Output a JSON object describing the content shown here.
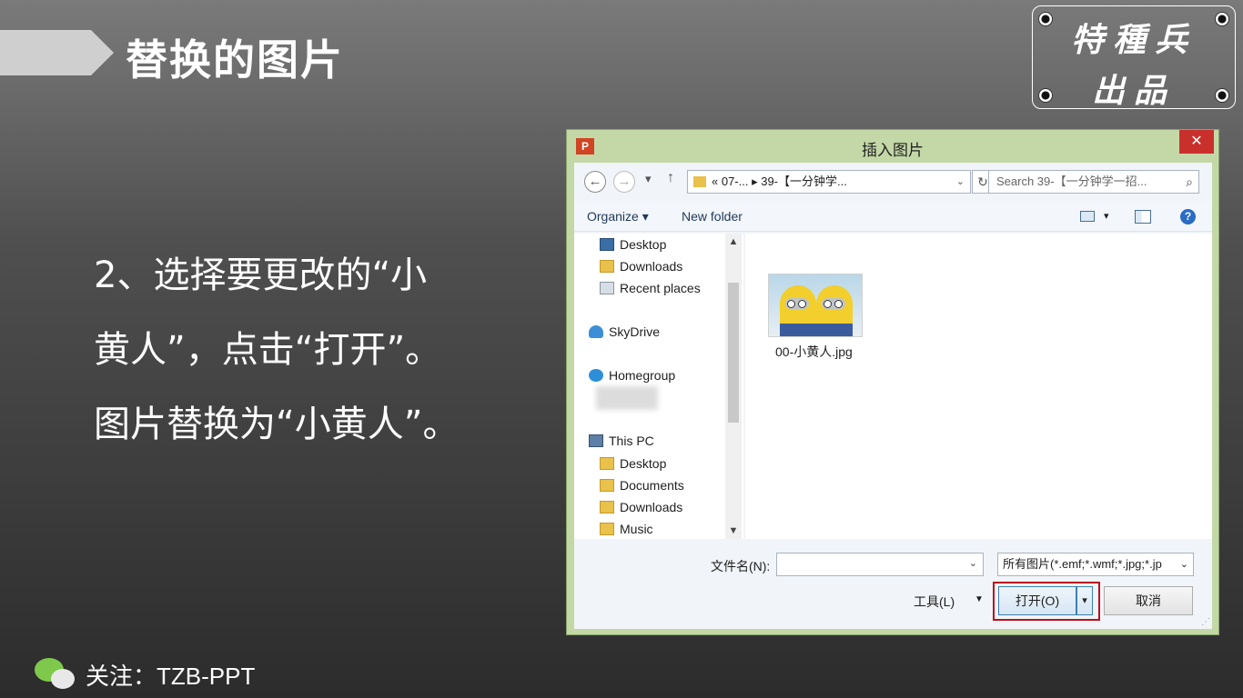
{
  "slide": {
    "title": "替换的图片",
    "brand_line1": "特種兵",
    "brand_line2": "出品",
    "instructions": [
      "2、选择要更改的“小",
      "黄人”，点击“打开”。",
      "图片替换为“小黄人”。"
    ],
    "footer": "关注：TZB-PPT"
  },
  "dialog": {
    "app_icon": "P",
    "title": "插入图片",
    "close": "✕",
    "nav": {
      "back": "←",
      "forward": "→",
      "recent_dropdown": "▾",
      "up": "↑",
      "address": "«  07-...  ▸  39-【一分钟学...",
      "address_dropdown": "⌄",
      "refresh": "↻",
      "search_placeholder": "Search 39-【一分钟学一招...",
      "search_icon": "⌕"
    },
    "commands": {
      "organize": "Organize ▾",
      "new_folder": "New folder",
      "view_dropdown": "▾",
      "help": "?"
    },
    "nav_pane": {
      "items": [
        "Desktop",
        "Downloads",
        "Recent places",
        "SkyDrive",
        "Homegroup",
        "This PC",
        "Desktop",
        "Documents",
        "Downloads",
        "Music"
      ],
      "scroll_up": "▲",
      "scroll_down": "▼"
    },
    "file": {
      "name": "00-小黄人.jpg"
    },
    "bottom": {
      "filename_label": "文件名(N):",
      "filename_value": "",
      "filename_dropdown": "⌄",
      "filetype": "所有图片(*.emf;*.wmf;*.jpg;*.jp",
      "filetype_dropdown": "⌄",
      "tools": "工具(L)",
      "tools_dropdown": "▼",
      "open": "打开(O)",
      "open_split": "▾",
      "cancel": "取消"
    }
  },
  "colors": {
    "accent_frame": "#b80f1f",
    "dialog_frame": "#c4d8a7",
    "close": "#c9302c"
  }
}
